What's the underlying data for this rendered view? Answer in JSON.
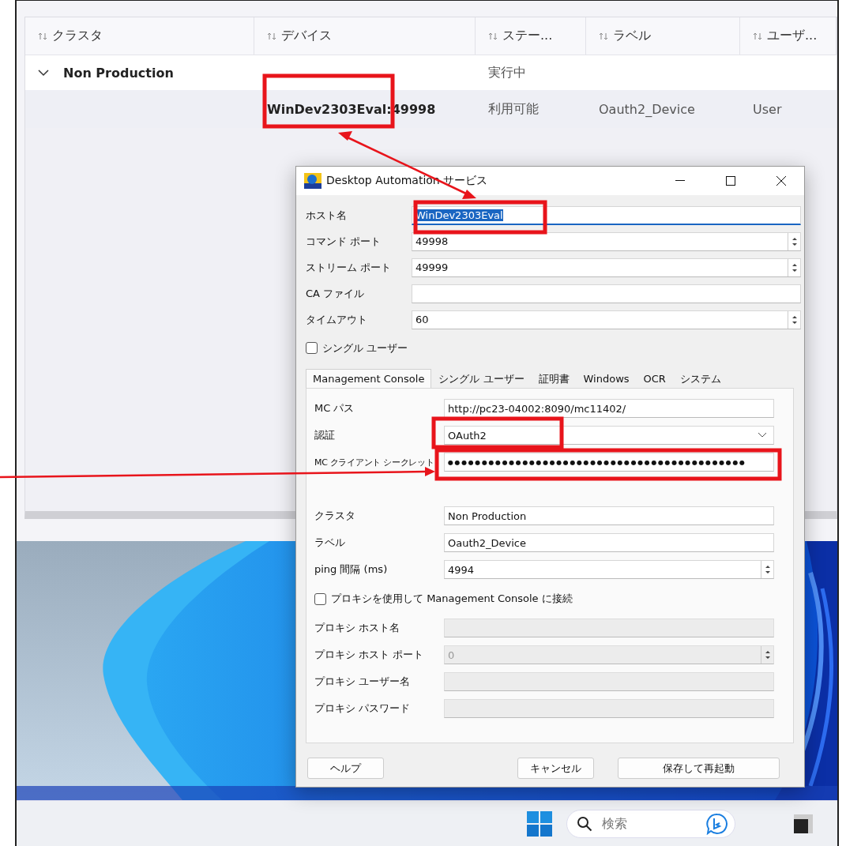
{
  "table": {
    "columns": [
      {
        "label": "クラスタ"
      },
      {
        "label": "デバイス"
      },
      {
        "label": "ステー..."
      },
      {
        "label": "ラベル"
      },
      {
        "label": "ユーザ..."
      }
    ],
    "groups": [
      {
        "name": "Non Production",
        "status": "実行中",
        "expanded": true,
        "rows": [
          {
            "device": "WinDev2303Eval:49998",
            "status": "利用可能",
            "label": "Oauth2_Device",
            "user": "User"
          }
        ]
      }
    ]
  },
  "dialog": {
    "title": "Desktop Automation サービス",
    "fields": [
      {
        "kind": "text",
        "label": "ホスト名",
        "value": "WinDev2303Eval",
        "focused": true
      },
      {
        "kind": "spin",
        "label": "コマンド ポート",
        "value": "49998",
        "focused": false
      },
      {
        "kind": "spin",
        "label": "ストリーム ポート",
        "value": "49999",
        "focused": false
      },
      {
        "kind": "text",
        "label": "CA ファイル",
        "focused": false
      },
      {
        "kind": "spin",
        "label": "タイムアウト",
        "value": "60",
        "focused": false
      },
      {
        "kind": "checkbox",
        "label": "シングル ユーザー",
        "checked": false
      }
    ],
    "tabs": [
      {
        "label": "Management Console",
        "selected": true
      },
      {
        "label": "シングル ユーザー",
        "selected": false
      },
      {
        "label": "証明書",
        "selected": false
      },
      {
        "label": "Windows",
        "selected": false
      },
      {
        "label": "OCR",
        "selected": false
      },
      {
        "label": "システム",
        "selected": false
      }
    ],
    "tab_fields": [
      {
        "kind": "text",
        "label": "MC パス",
        "value": "http://pc23-04002:8090/mc11402/",
        "disabled": false
      },
      {
        "kind": "combo",
        "label": "認証",
        "value": "OAuth2",
        "disabled": false
      },
      {
        "kind": "password",
        "label": "MC クライアント シークレット",
        "value": "●●●●●●●●●●●●●●●●●●●●●●●●●●●●●●●●●●●●●●●●●●●●",
        "disabled": false
      },
      {
        "kind": "text",
        "label": "クラスタ",
        "value": "Non Production",
        "disabled": false
      },
      {
        "kind": "text",
        "label": "ラベル",
        "value": "Oauth2_Device",
        "disabled": false
      },
      {
        "kind": "spin",
        "label": "ping 間隔 (ms)",
        "value": "4994",
        "disabled": false
      },
      {
        "kind": "checkbox",
        "label": "プロキシを使用して Management Console に接続",
        "checked": false
      },
      {
        "kind": "text",
        "label": "プロキシ ホスト名",
        "disabled": true
      },
      {
        "kind": "spin",
        "label": "プロキシ ホスト ポート",
        "value": "0",
        "disabled": true
      },
      {
        "kind": "text",
        "label": "プロキシ ユーザー名",
        "disabled": true
      },
      {
        "kind": "text",
        "label": "プロキシ パスワード",
        "disabled": true
      }
    ],
    "buttons": [
      {
        "label": "ヘルプ"
      },
      {
        "label": "キャンセル"
      },
      {
        "label": "保存して再起動"
      }
    ]
  },
  "taskbar": {
    "search": {
      "placeholder": "検索"
    }
  }
}
